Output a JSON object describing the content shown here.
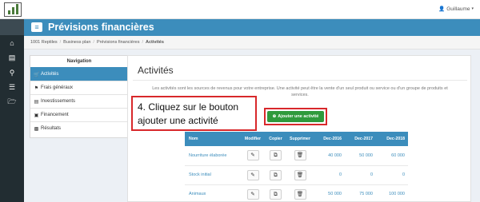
{
  "app": {
    "title": "Prévisions financières",
    "menu_icon": "hamburger-icon"
  },
  "user": {
    "name": "Guillaume",
    "icon": "user-icon"
  },
  "breadcrumb": [
    "1001 Reptiles",
    "Business plan",
    "Prévisions financières",
    "Activités"
  ],
  "navigation": {
    "title": "Navigation",
    "items": [
      {
        "label": "Activités",
        "icon": "cart-icon",
        "active": true
      },
      {
        "label": "Frais généraux",
        "icon": "flag-icon",
        "active": false
      },
      {
        "label": "Investissements",
        "icon": "building-icon",
        "active": false
      },
      {
        "label": "Financement",
        "icon": "money-icon",
        "active": false
      },
      {
        "label": "Résultats",
        "icon": "bar-chart-icon",
        "active": false
      }
    ]
  },
  "main": {
    "title": "Activités",
    "description": "Les activités sont les sources de revenus pour votre entreprise. Une activité peut être la vente d'un seul produit ou service ou d'un groupe de produits et services.",
    "add_button": "Ajouter une activité",
    "callout": "4. Cliquez sur le bouton ajouter une activité"
  },
  "table": {
    "headers": [
      "Nom",
      "Modifier",
      "Copier",
      "Supprimer",
      "Dec-2016",
      "Dec-2017",
      "Dec-2018"
    ],
    "rows": [
      {
        "name": "Nourriture élaborée",
        "values": [
          "40 000",
          "50 000",
          "60 000"
        ]
      },
      {
        "name": "Stock initial",
        "values": [
          "0",
          "0",
          "0"
        ]
      },
      {
        "name": "Animaux",
        "values": [
          "50 000",
          "75 000",
          "100 000"
        ]
      }
    ]
  },
  "sidebar_rail": [
    "home-icon",
    "dashboard-icon",
    "search-icon",
    "list-icon",
    "folder-icon"
  ],
  "colors": {
    "primary": "#3c8dbc",
    "success": "#2f9a3c",
    "highlight": "#d8282b",
    "rail": "#222d32"
  }
}
